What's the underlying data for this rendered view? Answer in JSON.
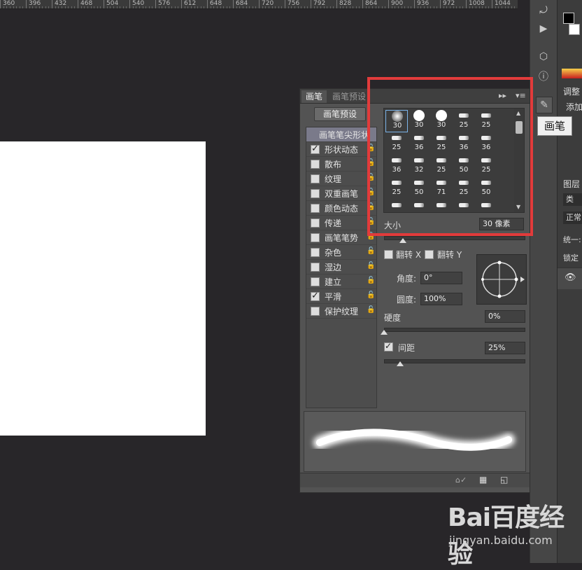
{
  "ruler": {
    "marks": [
      "360",
      "396",
      "432",
      "468",
      "504",
      "540",
      "576",
      "612",
      "648",
      "684",
      "720",
      "756",
      "792",
      "828",
      "864",
      "900",
      "936",
      "972",
      "1008",
      "1044"
    ]
  },
  "brush_panel": {
    "tabs": [
      "画笔",
      "画笔预设"
    ],
    "preset_button": "画笔预设",
    "tip_shape_label": "画笔笔尖形状",
    "options": [
      {
        "label": "形状动态",
        "checked": true
      },
      {
        "label": "散布",
        "checked": false
      },
      {
        "label": "纹理",
        "checked": false
      },
      {
        "label": "双重画笔",
        "checked": false
      },
      {
        "label": "颜色动态",
        "checked": false
      },
      {
        "label": "传递",
        "checked": false
      },
      {
        "label": "画笔笔势",
        "checked": false
      },
      {
        "label": "杂色",
        "checked": false
      },
      {
        "label": "湿边",
        "checked": false
      },
      {
        "label": "建立",
        "checked": false
      },
      {
        "label": "平滑",
        "checked": true
      },
      {
        "label": "保护纹理",
        "checked": false
      }
    ],
    "brush_sizes": [
      [
        "30",
        "30",
        "30",
        "25",
        "25"
      ],
      [
        "25",
        "36",
        "25",
        "36",
        "36"
      ],
      [
        "36",
        "32",
        "25",
        "50",
        "25"
      ],
      [
        "25",
        "50",
        "71",
        "25",
        "50"
      ],
      [
        "",
        "",
        "",
        "",
        ""
      ]
    ],
    "size_label": "大小",
    "size_value": "30 像素",
    "flip_x": "翻转 X",
    "flip_y": "翻转 Y",
    "angle_label": "角度:",
    "angle_value": "0°",
    "roundness_label": "圆度:",
    "roundness_value": "100%",
    "hardness_label": "硬度",
    "hardness_value": "0%",
    "spacing_label": "间距",
    "spacing_value": "25%",
    "spacing_checked": true
  },
  "tooltip": "画笔",
  "right_panel": {
    "adjust": "调整",
    "add": "添加",
    "layers": "图层",
    "kind": "类",
    "normal": "正常",
    "unify": "统一:",
    "lock": "锁定"
  },
  "watermark": {
    "logo": "Bai百度经验",
    "url": "jingyan.baidu.com"
  },
  "colors": {
    "highlight": "#e23b3b",
    "panel": "#535353",
    "canvas": "#ffffff"
  }
}
